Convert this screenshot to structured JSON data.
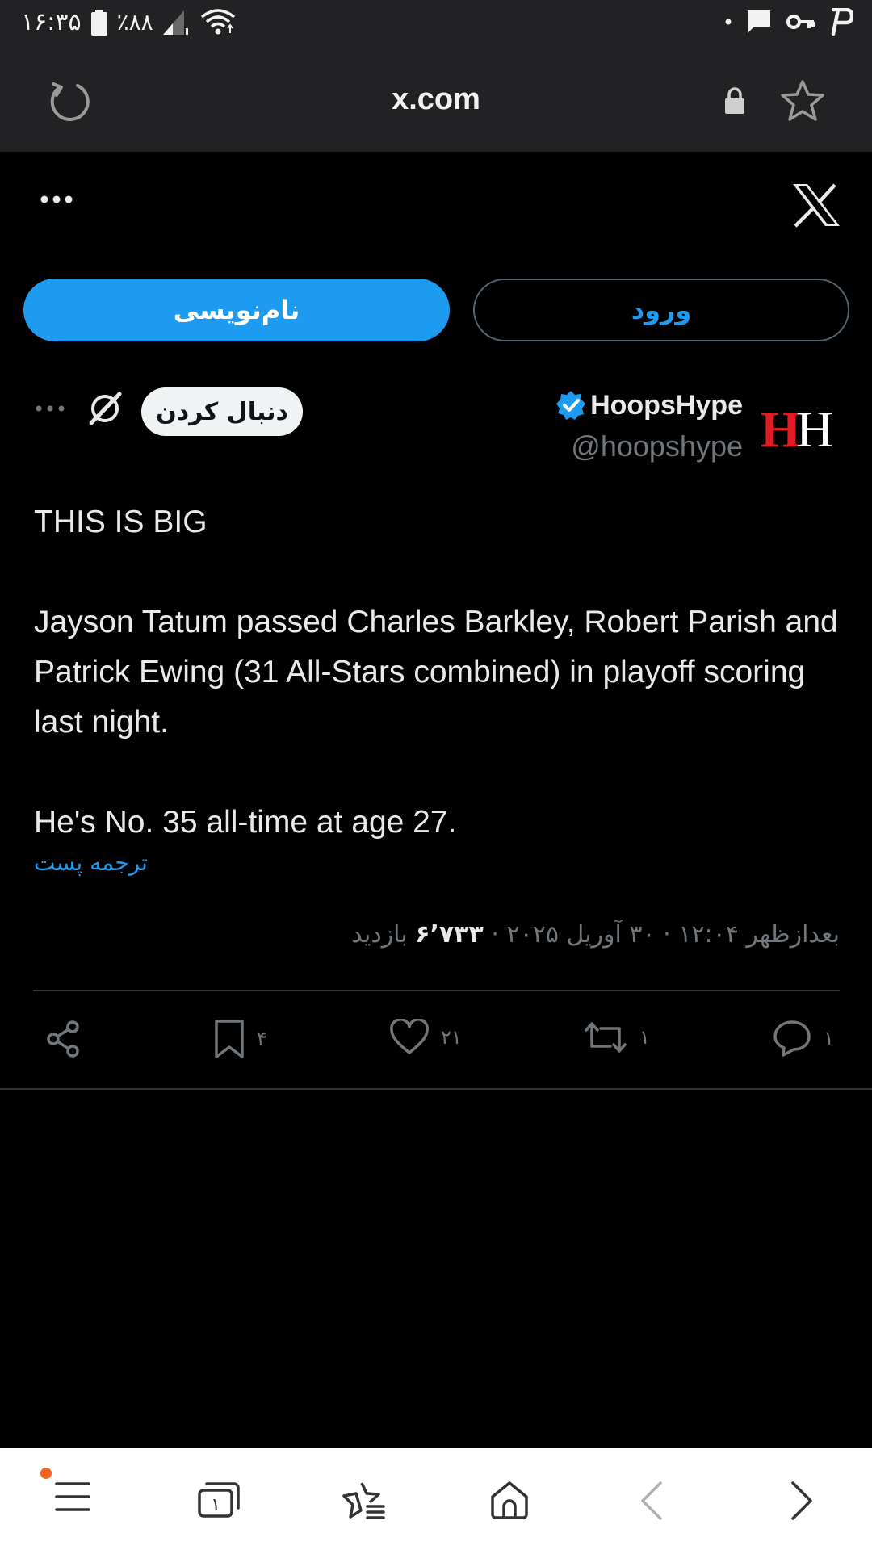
{
  "status_bar": {
    "time": "۱۶:۳۵",
    "battery": "٪۸۸"
  },
  "browser": {
    "url": "x.com"
  },
  "header": {
    "signup_label": "نام‌نویسی",
    "login_label": "ورود"
  },
  "author": {
    "name": "HoopsHype",
    "handle": "@hoopshype",
    "follow_label": "دنبال کردن",
    "avatar_text_1": "H",
    "avatar_text_2": "H",
    "colors": {
      "avatar_red": "#e31b23",
      "verified": "#1d9bf0"
    }
  },
  "post": {
    "line1": "THIS IS BIG",
    "line2": "Jayson Tatum passed Charles Barkley, Robert Parish and Patrick Ewing (31 All-Stars combined) in playoff scoring last night.",
    "line3": "He's No. 35 all-time at age 27.",
    "translate_label": "ترجمه پست",
    "time": "بعدازظهر ۱۲:۰۴",
    "date": "۳۰ آوریل ۲۰۲۵",
    "views_count": "۶٬۷۳۳",
    "views_label": "بازدید"
  },
  "actions": {
    "replies": "۱",
    "reposts": "۱",
    "likes": "۲۱",
    "bookmarks": "۴"
  },
  "colors": {
    "accent": "#1d9bf0",
    "background": "#000000",
    "chrome": "#222224",
    "notification_dot": "#f26522"
  }
}
